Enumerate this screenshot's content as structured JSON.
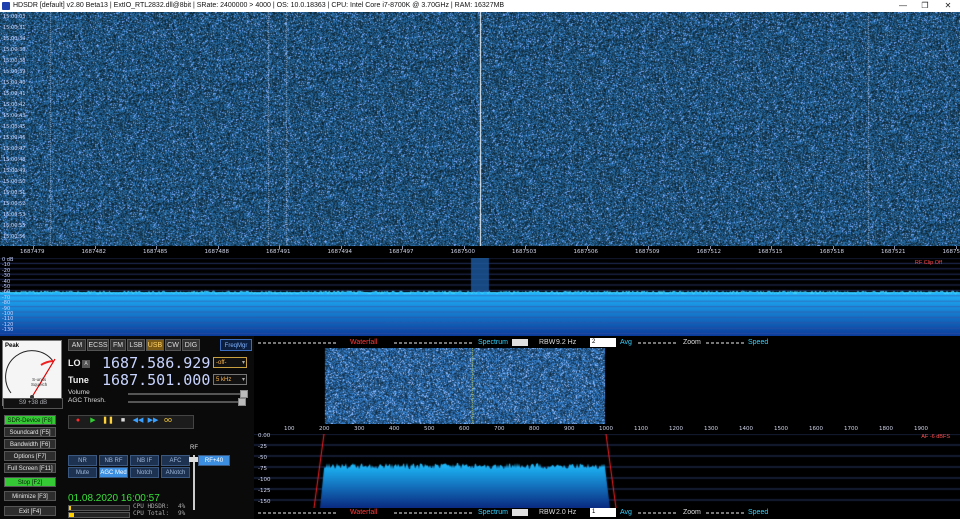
{
  "window": {
    "title": "HDSDR  [default]  v2.80 Beta13  |  ExtIO_RTL2832.dll@8bit  |  SRate: 2400000 > 4000  |  OS: 10.0.18363  |  CPU: Intel Core i7-8700K @ 3.70GHz  |  RAM: 16327MB",
    "minimize": "—",
    "maximize": "❐",
    "close": "✕"
  },
  "waterfall_times": [
    "15:00:03",
    "15:00:31",
    "15:00:34",
    "15:00:36",
    "15:00:38",
    "15:00:39",
    "15:00:40",
    "15:00:41",
    "15:00:42",
    "15:00:43",
    "15:00:45",
    "15:00:46",
    "15:00:47",
    "15:00:48",
    "15:00:49",
    "15:00:50",
    "15:00:51",
    "15:00:52",
    "15:00:53",
    "15:00:55",
    "15:00:56"
  ],
  "freq_ticks": [
    "1687479",
    "1687482",
    "1687485",
    "1687488",
    "1687491",
    "1687494",
    "1687497",
    "1687500",
    "1687503",
    "1687506",
    "1687509",
    "1687512",
    "1687515",
    "1687518",
    "1687521",
    "1687524"
  ],
  "spectrum_db_labels": [
    "0 dB",
    "-10",
    "-20",
    "-30",
    "-40",
    "-50",
    "-60",
    "-70",
    "-80",
    "-90",
    "-100",
    "-110",
    "-120",
    "-130"
  ],
  "spectrum_status": "RF Clip Off",
  "smeter": {
    "peak_label": "Peak",
    "units_label": "S-units\nSquelch",
    "scale_marks": [
      "1",
      "3",
      "5",
      "7",
      "9",
      "+20",
      "+40"
    ],
    "readout": "S9 +38 dB"
  },
  "modes": [
    {
      "label": "AM",
      "active": false
    },
    {
      "label": "ECSS",
      "active": false
    },
    {
      "label": "FM",
      "active": false
    },
    {
      "label": "LSB",
      "active": false
    },
    {
      "label": "USB",
      "active": true
    },
    {
      "label": "CW",
      "active": false
    },
    {
      "label": "DIG",
      "active": false
    }
  ],
  "freqmgr": "FreqMgr",
  "lo": {
    "label": "LO",
    "badge": "A",
    "value": "1687.586.929",
    "select": "-off-"
  },
  "tune": {
    "label": "Tune",
    "value": "1687.501.000",
    "step": "5 kHz"
  },
  "volume_label": "Volume",
  "agc_label": "AGC Thresh.",
  "side_buttons": [
    {
      "label": "SDR-Device  [F8]",
      "style": "green"
    },
    {
      "label": "Soundcard  [F5]",
      "style": "dark"
    },
    {
      "label": "Bandwidth  [F6]",
      "style": "dark"
    },
    {
      "label": "Options  [F7]",
      "style": "dark"
    },
    {
      "label": "Full Screen  [F11]",
      "style": "dark"
    },
    {
      "label": "Stop  [F2]",
      "style": "green"
    },
    {
      "label": "Minimize  [F3]",
      "style": "dark"
    },
    {
      "label": "Exit  [F4]",
      "style": "dark"
    }
  ],
  "transport": [
    "●",
    "▶",
    "❚❚",
    "■",
    "◀◀",
    "▶▶",
    "oo"
  ],
  "func_row1": [
    "NR",
    "NB RF",
    "NB IF",
    "AFC"
  ],
  "func_row2": [
    "Mute",
    "AGC Med",
    "Notch",
    "ANotch"
  ],
  "rf_label": "RF",
  "rf_value": "RF+40",
  "datetime": "01.08.2020  16:00:57",
  "cpu": [
    {
      "label": "CPU HDSDR:",
      "value": "4%",
      "fill": 0.04
    },
    {
      "label": "CPU Total:",
      "value": "9%",
      "fill": 0.09
    }
  ],
  "toolbar_top": {
    "waterfall": "Waterfall",
    "spectrum": "Spectrum",
    "rbw_label": "RBW",
    "rbw_value": "9.2 Hz",
    "avg_sel": "2",
    "avg": "Avg",
    "zoom": "Zoom",
    "speed": "Speed"
  },
  "toolbar_bottom": {
    "waterfall": "Waterfall",
    "spectrum": "Spectrum",
    "rbw_label": "RBW",
    "rbw_value": "2.0 Hz",
    "avg_sel": "1",
    "avg": "Avg",
    "zoom": "Zoom",
    "speed": "Speed"
  },
  "audio_ticks": [
    "100",
    "200",
    "300",
    "400",
    "500",
    "600",
    "700",
    "800",
    "900",
    "1000",
    "1100",
    "1200",
    "1300",
    "1400",
    "1500",
    "1600",
    "1700",
    "1800",
    "1900"
  ],
  "audio_db_labels": [
    "0.00",
    "-25",
    "-50",
    "-75",
    "-100",
    "-125",
    "-150"
  ],
  "af_label": "AF  -6 dBFS",
  "colors": {
    "accent": "#33d2ff",
    "red": "#ff3b3b",
    "green": "#36c936",
    "usb_active": "#7a5a14"
  }
}
